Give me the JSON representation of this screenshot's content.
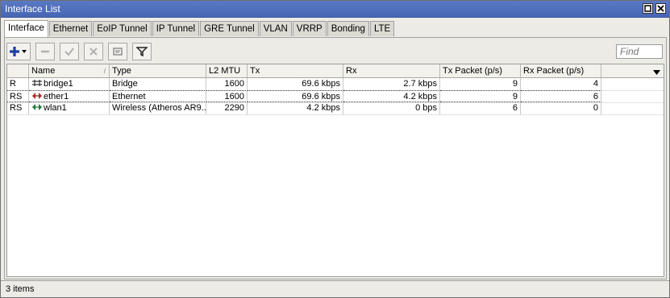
{
  "window": {
    "title": "Interface List"
  },
  "tabs": [
    "Interface",
    "Ethernet",
    "EoIP Tunnel",
    "IP Tunnel",
    "GRE Tunnel",
    "VLAN",
    "VRRP",
    "Bonding",
    "LTE"
  ],
  "find": {
    "placeholder": "Find"
  },
  "columns": [
    "",
    "Name",
    "Type",
    "L2 MTU",
    "Tx",
    "Rx",
    "Tx Packet (p/s)",
    "Rx Packet (p/s)"
  ],
  "rows": [
    {
      "flags": "R",
      "name": "bridge1",
      "type": "Bridge",
      "mtu": "1600",
      "tx": "69.6 kbps",
      "rx": "2.7 kbps",
      "txp": "9",
      "rxp": "4",
      "icon": "bridge-icon"
    },
    {
      "flags": "RS",
      "name": "ether1",
      "type": "Ethernet",
      "mtu": "1600",
      "tx": "69.6 kbps",
      "rx": "4.2 kbps",
      "txp": "9",
      "rxp": "6",
      "icon": "ethernet-icon"
    },
    {
      "flags": "RS",
      "name": "wlan1",
      "type": "Wireless (Atheros AR9...",
      "mtu": "2290",
      "tx": "4.2 kbps",
      "rx": "0 bps",
      "txp": "6",
      "rxp": "0",
      "icon": "wireless-icon"
    }
  ],
  "status": {
    "items": "3 items"
  },
  "colors": {
    "titlebar": "#4a69b8",
    "add": "#1f3fa0",
    "ethernet_icon": "#c02020",
    "wireless_icon": "#1a7a3a"
  }
}
